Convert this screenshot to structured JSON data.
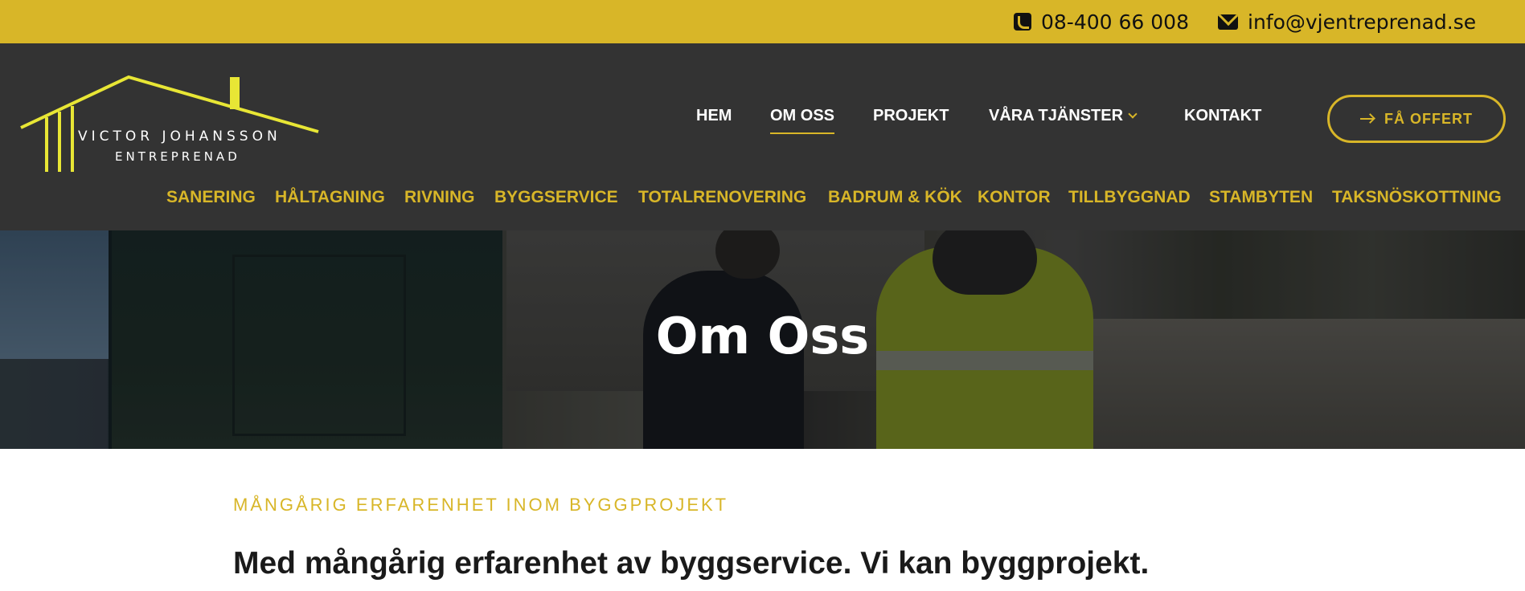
{
  "topbar": {
    "phone": "08-400 66 008",
    "email": "info@vjentreprenad.se"
  },
  "logo": {
    "line1": "VICTOR JOHANSSON",
    "line2": "ENTREPRENAD"
  },
  "nav": {
    "items": [
      {
        "label": "HEM"
      },
      {
        "label": "OM OSS",
        "active": true
      },
      {
        "label": "PROJEKT"
      },
      {
        "label": "VÅRA TJÄNSTER",
        "has_dropdown": true
      },
      {
        "label": "KONTAKT"
      }
    ],
    "cta": "FÅ OFFERT"
  },
  "services_nav": {
    "items": [
      "SANERING",
      "HÅLTAGNING",
      "RIVNING",
      "BYGGSERVICE",
      "TOTALRENOVERING",
      "BADRUM & KÖK",
      "KONTOR",
      "TILLBYGGNAD",
      "STAMBYTEN",
      "TAKSNÖSKOTTNING"
    ]
  },
  "hero": {
    "title": "Om Oss"
  },
  "content": {
    "eyebrow": "MÅNGÅRIG ERFARENHET INOM BYGGPROJEKT",
    "headline": "Med mångårig erfarenhet av byggservice. Vi kan byggprojekt."
  },
  "colors": {
    "brand_yellow": "#d8b628",
    "header_bg": "#333333",
    "logo_lime": "#e8e635"
  }
}
